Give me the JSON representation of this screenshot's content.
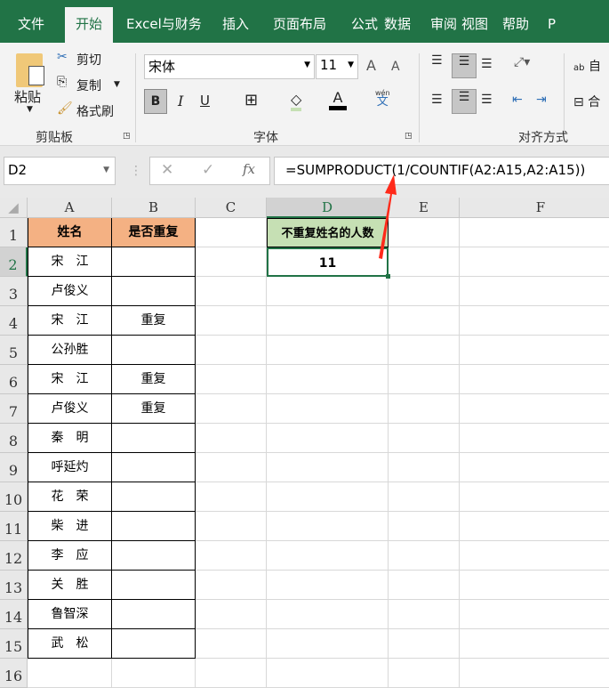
{
  "tabs": [
    "文件",
    "开始",
    "Excel与财务",
    "插入",
    "页面布局",
    "公式",
    "数据",
    "审阅",
    "视图",
    "帮助",
    "P"
  ],
  "ribbon": {
    "clipboard": {
      "paste": "粘贴",
      "cut": "剪切",
      "copy": "复制",
      "format_painter": "格式刷",
      "label": "剪贴板"
    },
    "font": {
      "name": "宋体",
      "size": "11",
      "bold": "B",
      "italic": "I",
      "underline": "U",
      "font_color": "A",
      "phonetic_top": "wén",
      "phonetic": "文",
      "label": "字体",
      "grow": "A",
      "shrink": "A"
    },
    "alignment": {
      "label": "对齐方式",
      "wrap": "自",
      "merge": "合",
      "wrap_icon": "ab"
    }
  },
  "formula_bar": {
    "name_box": "D2",
    "formula": "=SUMPRODUCT(1/COUNTIF(A2:A15,A2:A15))",
    "fx": "fx",
    "cancel": "✕",
    "enter": "✓"
  },
  "columns": [
    "A",
    "B",
    "C",
    "D",
    "E",
    "F"
  ],
  "rows": [
    "1",
    "2",
    "3",
    "4",
    "5",
    "6",
    "7",
    "8",
    "9",
    "10",
    "11",
    "12",
    "13",
    "14",
    "15",
    "16"
  ],
  "headers": {
    "a": "姓名",
    "b": "是否重复",
    "d": "不重复姓名的人数"
  },
  "result": "11",
  "data": [
    {
      "name": "宋　江",
      "dup": ""
    },
    {
      "name": "卢俊义",
      "dup": ""
    },
    {
      "name": "宋　江",
      "dup": "重复"
    },
    {
      "name": "公孙胜",
      "dup": ""
    },
    {
      "name": "宋　江",
      "dup": "重复"
    },
    {
      "name": "卢俊义",
      "dup": "重复"
    },
    {
      "name": "秦　明",
      "dup": ""
    },
    {
      "name": "呼延灼",
      "dup": ""
    },
    {
      "name": "花　荣",
      "dup": ""
    },
    {
      "name": "柴　进",
      "dup": ""
    },
    {
      "name": "李　应",
      "dup": ""
    },
    {
      "name": "关　胜",
      "dup": ""
    },
    {
      "name": "鲁智深",
      "dup": ""
    },
    {
      "name": "武　松",
      "dup": ""
    }
  ],
  "colors": {
    "ribbon_green": "#217346",
    "header_orange": "#f4b183",
    "header_green": "#c6e0b4",
    "arrow": "#ff2a1a"
  }
}
